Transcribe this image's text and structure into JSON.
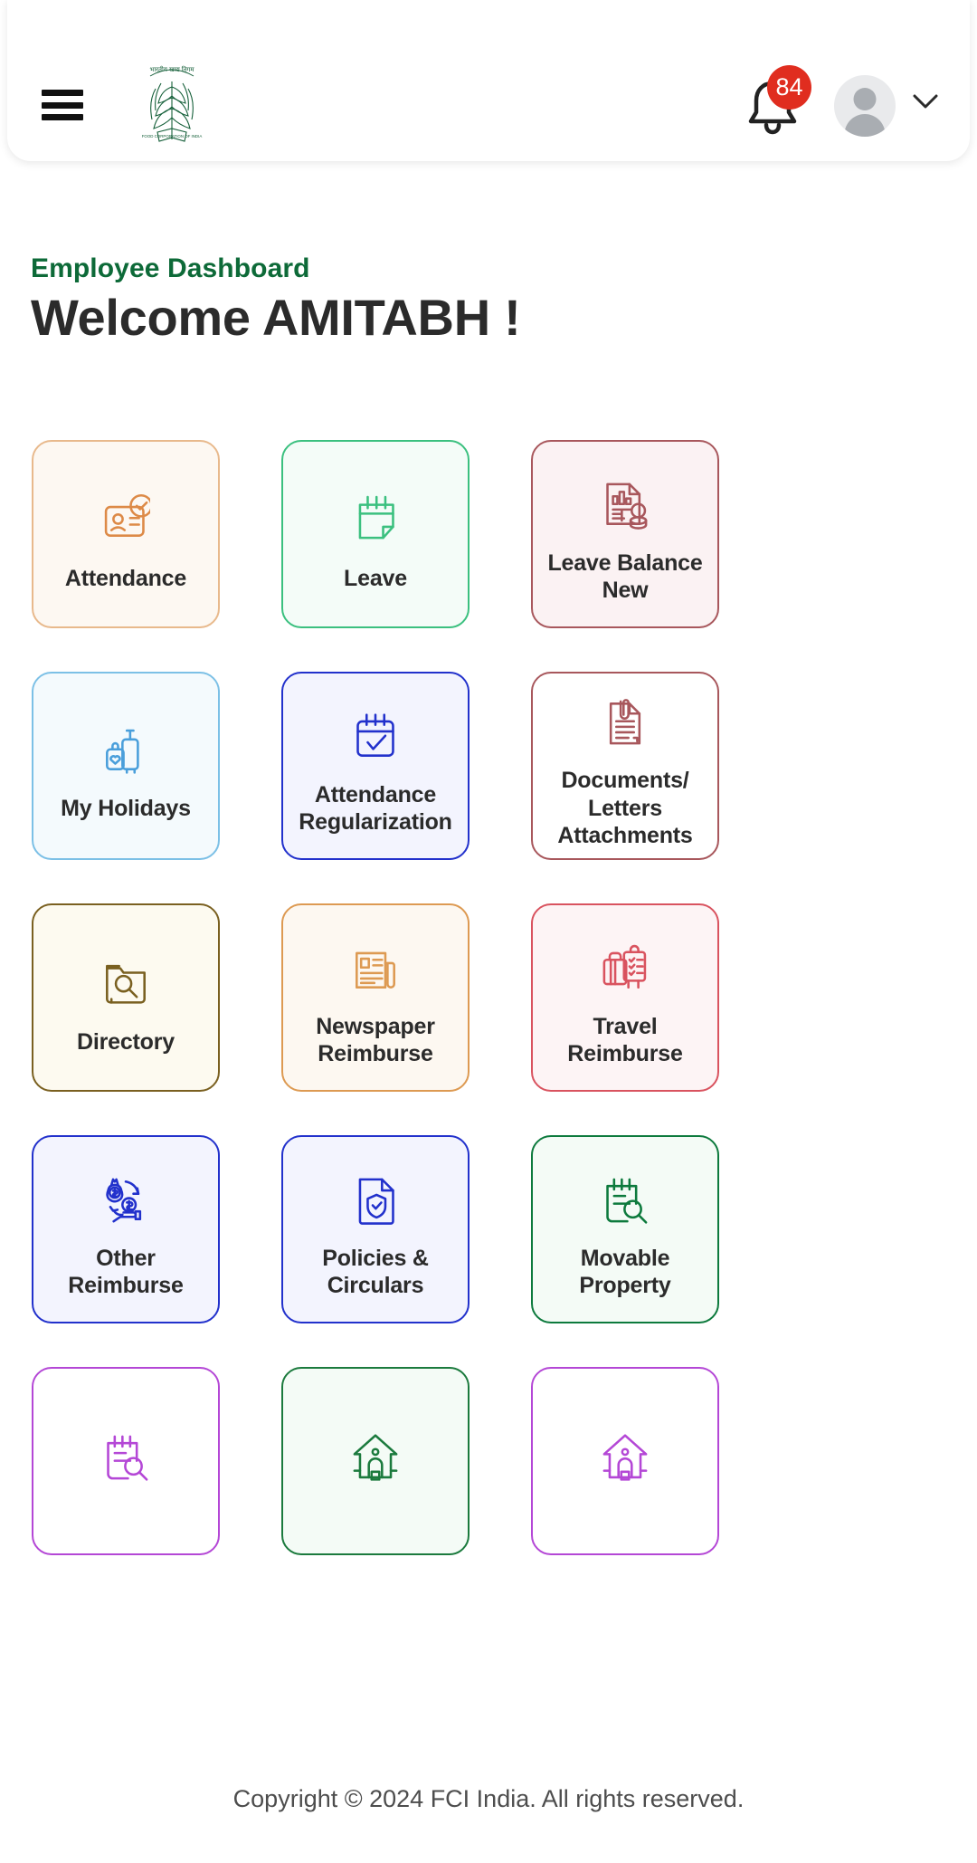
{
  "header": {
    "menu_label": "menu",
    "logo_alt": "FCI India emblem",
    "notification_count": "84",
    "profile_label": "profile",
    "chevron_label": "account menu"
  },
  "page": {
    "eyebrow": "Employee Dashboard",
    "welcome": "Welcome AMITABH !"
  },
  "colors": {
    "brand_green": "#0d6a38",
    "badge_red": "#e02d1f",
    "title_dark": "#2b2b2b"
  },
  "cards": [
    {
      "label": "Attendance",
      "icon": "id-card-check-icon",
      "accent": "#dd8a47",
      "bg": "#fdf8f2",
      "border": "#e8b98c"
    },
    {
      "label": "Leave",
      "icon": "calendar-note-icon",
      "accent": "#3bc07f",
      "bg": "#f4fcf8",
      "border": "#3bc07f"
    },
    {
      "label": "Leave Balance New",
      "icon": "report-chart-search-icon",
      "accent": "#a8575c",
      "bg": "#fbf2f3",
      "border": "#a8575c"
    },
    {
      "label": "My Holidays",
      "icon": "luggage-icon",
      "accent": "#4a9fdb",
      "bg": "#f4fafd",
      "border": "#7cc0e6"
    },
    {
      "label": "Attendance Regularization",
      "icon": "calendar-check-icon",
      "accent": "#2231cc",
      "bg": "#f3f4fe",
      "border": "#2231cc"
    },
    {
      "label": "Documents/ Letters Attachments",
      "icon": "document-attachment-icon",
      "accent": "#a8575c",
      "bg": "#ffffff",
      "border": "#a8575c"
    },
    {
      "label": "Directory",
      "icon": "folder-search-icon",
      "accent": "#7a6020",
      "bg": "#fdfaf0",
      "border": "#7a6020"
    },
    {
      "label": "Newspaper Reimburse",
      "icon": "newspaper-icon",
      "accent": "#dd9a52",
      "bg": "#fdf8f1",
      "border": "#dd9a52"
    },
    {
      "label": "Travel Reimburse",
      "icon": "suitcase-clipboard-icon",
      "accent": "#d9535f",
      "bg": "#fdf4f5",
      "border": "#d9535f"
    },
    {
      "label": "Other Reimburse",
      "icon": "money-exchange-icon",
      "accent": "#2231cc",
      "bg": "#f3f4fe",
      "border": "#2231cc"
    },
    {
      "label": "Policies & Circulars",
      "icon": "document-shield-icon",
      "accent": "#2231cc",
      "bg": "#f3f4fe",
      "border": "#2231cc"
    },
    {
      "label": "Movable Property",
      "icon": "notepad-search-icon",
      "accent": "#0d7a3d",
      "bg": "#f4fbf6",
      "border": "#0d7a3d"
    },
    {
      "label": "",
      "icon": "notepad-search-purple-icon",
      "accent": "#b447d6",
      "bg": "#ffffff",
      "border": "#b447d6"
    },
    {
      "label": "",
      "icon": "house-lock-green-icon",
      "accent": "#1b7a3d",
      "bg": "#f4fbf6",
      "border": "#1b7a3d"
    },
    {
      "label": "",
      "icon": "house-lock-purple-icon",
      "accent": "#b447d6",
      "bg": "#ffffff",
      "border": "#b447d6"
    }
  ],
  "footer": {
    "copyright": "Copyright ©  2024 FCI India. All rights reserved."
  }
}
